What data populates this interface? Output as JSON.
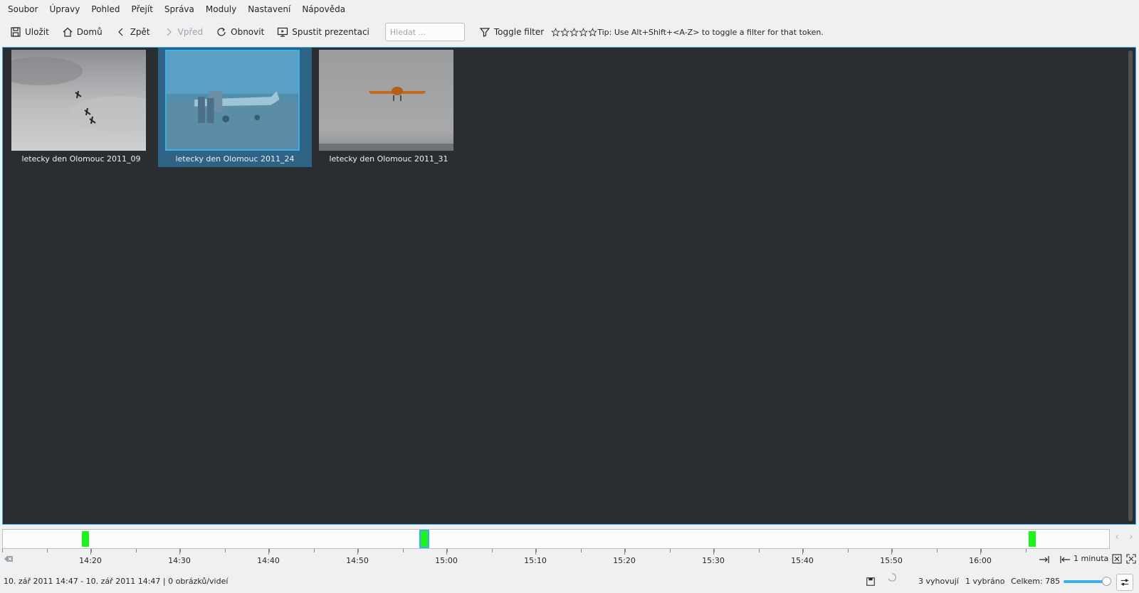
{
  "menu": [
    "Soubor",
    "Úpravy",
    "Pohled",
    "Přejít",
    "Správa",
    "Moduly",
    "Nastavení",
    "Nápověda"
  ],
  "toolbar": {
    "save": "Uložit",
    "home": "Domů",
    "back": "Zpět",
    "forward": "Vpřed",
    "refresh": "Obnovit",
    "slideshow": "Spustit prezentaci",
    "search_placeholder": "Hledat ...",
    "toggle_filter": "Toggle filter",
    "tip": "Tip: Use Alt+Shift+<A-Z> to toggle a filter for that token."
  },
  "thumbnails": [
    {
      "caption": "letecky den Olomouc 2011_09",
      "selected": false
    },
    {
      "caption": "letecky den Olomouc 2011_24",
      "selected": true
    },
    {
      "caption": "letecky den Olomouc 2011_31",
      "selected": false
    }
  ],
  "timeline": {
    "labels": [
      "14:20",
      "14:30",
      "14:40",
      "14:50",
      "15:00",
      "15:10",
      "15:20",
      "15:30",
      "15:40",
      "15:50",
      "16:00"
    ],
    "scale": "1 minuta",
    "marker_color": "#1cf41c"
  },
  "status": {
    "range": "10. zář 2011 14:47 - 10. zář 2011 14:47 | 0 obrázků/videí",
    "matching": "3 vyhovují",
    "selected": "1 vybráno",
    "total": "Celkem: 785"
  },
  "colors": {
    "accent": "#3daee9",
    "view_background": "#2a2e32",
    "selection": "#2e6385"
  }
}
